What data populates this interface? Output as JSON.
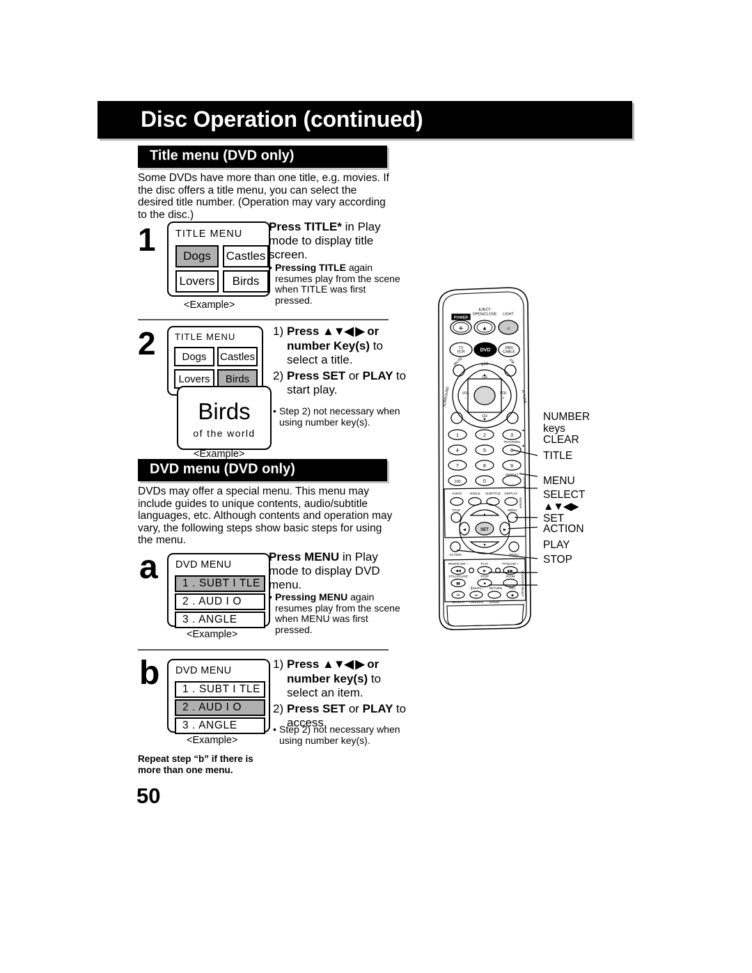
{
  "page": {
    "title": "Disc Operation (continued)",
    "number": "50"
  },
  "sections": [
    {
      "id": "title-menu",
      "heading": "Title menu (DVD only)",
      "intro": "Some DVDs have more than one title, e.g. movies. If the disc offers a title menu, you can select the desired title number. (Operation may vary according to the disc.)"
    },
    {
      "id": "dvd-menu",
      "heading": "DVD menu (DVD only)",
      "intro": "DVDs may offer a special menu. This menu may include guides to unique contents, audio/subtitle languages, etc. Although contents and operation may vary, the following steps show basic steps for using the menu."
    }
  ],
  "steps": {
    "one": {
      "marker": "1",
      "screen": {
        "title": "TITLE  MENU",
        "cells": [
          "Dogs",
          "Castles",
          "Lovers",
          "Birds"
        ],
        "selected_index": 0,
        "caption": "<Example>"
      },
      "instruction_bold": "Press TITLE* ",
      "instruction_rest": "in Play mode to display title screen.",
      "bullet_bold": "Pressing TITLE ",
      "bullet_rest": "again resumes play from the scene when TITLE was first pressed."
    },
    "two": {
      "marker": "2",
      "screen": {
        "title": "TITLE  MENU",
        "cells": [
          "Dogs",
          "Castles",
          "Lovers",
          "Birds"
        ],
        "selected_index": 3,
        "caption": "<Example>"
      },
      "overlay": {
        "big": "Birds",
        "small": "of  the  world"
      },
      "list": [
        {
          "num": "1)",
          "bold_a": "Press ",
          "arrows": "▲▼◀ ▶",
          "bold_b": " or number Key(s)",
          "rest": " to select a title."
        },
        {
          "num": "2)",
          "bold_a": "Press SET ",
          "rest_a": "or ",
          "bold_b": "PLAY ",
          "rest": "to start play."
        }
      ],
      "bullet": "Step 2) not necessary when using number key(s)."
    },
    "a": {
      "marker": "a",
      "screen": {
        "title": "DVD MENU",
        "items": [
          "1 . SUBT I TLE",
          "2 . AUD I O",
          "3 . ANGLE"
        ],
        "selected_index": 0,
        "caption": "<Example>"
      },
      "instruction_bold": "Press MENU ",
      "instruction_rest": "in Play mode to display DVD menu.",
      "bullet_bold": "Pressing MENU ",
      "bullet_rest": "again resumes play from the scene when MENU was first pressed."
    },
    "b": {
      "marker": "b",
      "screen": {
        "title": "DVD MENU",
        "items": [
          "1 . SUBT I TLE",
          "2 . AUD I O",
          "3 . ANGLE"
        ],
        "selected_index": 1,
        "caption": "<Example>"
      },
      "list": [
        {
          "num": "1)",
          "bold_a": "Press ",
          "arrows": "▲▼◀ ▶",
          "bold_b": " or number key(s)",
          "rest": " to select an item."
        },
        {
          "num": "2)",
          "bold_a": "Press SET ",
          "rest_a": "or ",
          "bold_b": "PLAY ",
          "rest": "to access."
        }
      ],
      "bullet": "Step 2) not necessary when using number key(s).",
      "note": "Repeat step “b” if there is more than one menu."
    }
  },
  "remote": {
    "top_row": [
      "POWER",
      "EJECT OPEN/CLOSE",
      "LIGHT"
    ],
    "mode_row": [
      "TV VCR",
      "DVD",
      "DBS CABLE"
    ],
    "ring_labels": [
      "MUTE",
      "≧10",
      "FM",
      "SURROUND",
      "R-TUNE",
      "CH",
      "VOL",
      "VOL",
      "CH"
    ],
    "number_keys": [
      "1",
      "2",
      "3",
      "4",
      "5",
      "6",
      "7",
      "8",
      "9",
      "100",
      "0",
      "ADD/DLT"
    ],
    "tracking_label": "TRACKING",
    "clear_label": "CLEAR",
    "func_row": [
      "AUDIO",
      "ANGLE",
      "SUBTITLE",
      "DISPLAY"
    ],
    "enter_label": "ENTER",
    "title_button": "TITLE",
    "menu_button": "MENU",
    "set_button": "SET",
    "action_button": "ACTION",
    "prog_button": "PROG",
    "transport_top": [
      "REW/SLOW −",
      "PLAY",
      "FF/SLOW +"
    ],
    "transport_mid": [
      "STILL/PAUSE",
      "STOP",
      "ZOOM"
    ],
    "transport_bot": [
      "−┐SKIP┌+",
      "RETURN",
      "REC"
    ],
    "transport_sub": [
      "SEARCH",
      "CM/ZERO",
      "SPEED"
    ],
    "counter_reset": "COUNTER RESET",
    "callouts": [
      {
        "id": "number-keys",
        "line1": "NUMBER",
        "line2": "keys"
      },
      {
        "id": "clear",
        "line1": "CLEAR"
      },
      {
        "id": "title",
        "line1": "TITLE"
      },
      {
        "id": "menu",
        "line1": "MENU"
      },
      {
        "id": "select",
        "line1": "SELECT",
        "line2": "▲▼◀▶",
        "line3": "SET"
      },
      {
        "id": "action",
        "line1": "ACTION"
      },
      {
        "id": "play",
        "line1": "PLAY"
      },
      {
        "id": "stop",
        "line1": "STOP"
      }
    ]
  }
}
